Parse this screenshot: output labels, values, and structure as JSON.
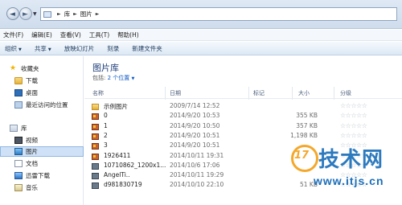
{
  "address": {
    "crumbs": [
      "库",
      "图片"
    ]
  },
  "menu": [
    "文件(F)",
    "编辑(E)",
    "查看(V)",
    "工具(T)",
    "帮助(H)"
  ],
  "toolbar": {
    "organize": "组织",
    "share": "共享",
    "slideshow": "放映幻灯片",
    "burn": "刻录",
    "new_folder": "新建文件夹"
  },
  "sidebar": {
    "favorites": "收藏夹",
    "downloads": "下载",
    "desktop": "桌面",
    "recent": "最近访问的位置",
    "library": "库",
    "videos": "视频",
    "pictures": "图片",
    "documents": "文档",
    "thunder": "迅雷下载",
    "music": "音乐"
  },
  "main": {
    "title": "图片库",
    "includes_label": "包括:",
    "includes_link": "2 个位置"
  },
  "columns": {
    "name": "名称",
    "date": "日期",
    "tags": "标记",
    "size": "大小",
    "rating": "分级"
  },
  "files": [
    {
      "name": "示例图片",
      "date": "2009/7/14 12:52",
      "size": "",
      "icon": "folder"
    },
    {
      "name": "0",
      "date": "2014/9/20 10:53",
      "size": "355 KB",
      "icon": "image"
    },
    {
      "name": "1",
      "date": "2014/9/20 10:50",
      "size": "357 KB",
      "icon": "image"
    },
    {
      "name": "2",
      "date": "2014/9/20 10:51",
      "size": "1,198 KB",
      "icon": "image"
    },
    {
      "name": "3",
      "date": "2014/9/20 10:51",
      "size": "",
      "icon": "image"
    },
    {
      "name": "1926411",
      "date": "2014/10/11 19:31",
      "size": "",
      "icon": "image"
    },
    {
      "name": "10710862_1200x1...",
      "date": "2014/10/6 17:06",
      "size": "",
      "icon": "photo"
    },
    {
      "name": "AngelTi..",
      "date": "2014/10/11 19:29",
      "size": "",
      "icon": "photo"
    },
    {
      "name": "d981830719",
      "date": "2014/10/10 22:10",
      "size": "51 KB",
      "icon": "photo"
    }
  ],
  "watermark": {
    "circle": "17",
    "main": "技术网",
    "sub": "www.itjs.cn"
  }
}
